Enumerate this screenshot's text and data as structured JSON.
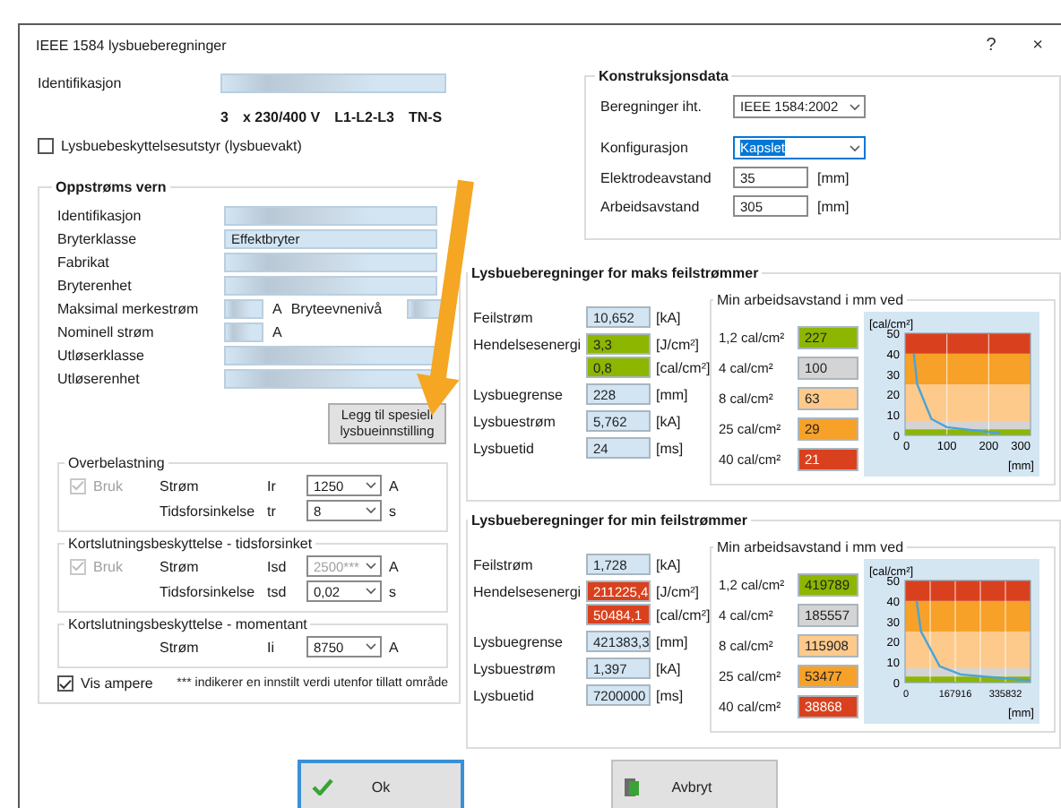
{
  "window": {
    "title": "IEEE 1584 lysbueberegninger",
    "help": "?",
    "close": "×"
  },
  "header": {
    "identification_label": "Identifikasjon",
    "system": [
      "3",
      "x 230/400 V",
      "L1-L2-L3",
      "TN-S"
    ],
    "arc_protection": {
      "label": "Lysbuebeskyttelsesutstyr (lysbuevakt)",
      "checked": false
    }
  },
  "upstream": {
    "title": "Oppstrøms vern",
    "fields": [
      {
        "kind": "blurred",
        "label": "Identifikasjon"
      },
      {
        "kind": "text",
        "label": "Bryterklasse",
        "value": "Effektbryter"
      },
      {
        "kind": "blurred",
        "label": "Fabrikat"
      },
      {
        "kind": "blurred",
        "label": "Bryterenhet"
      },
      {
        "kind": "current",
        "label": "Maksimal merkestrøm",
        "unit": "A",
        "extra_label": "Bryteevnenivå"
      },
      {
        "kind": "short",
        "label": "Nominell strøm",
        "unit": "A"
      },
      {
        "kind": "blurred",
        "label": "Utløserklasse"
      },
      {
        "kind": "blurred",
        "label": "Utløserenhet"
      }
    ],
    "button": "Legg til spesiell lysbueinnstilling",
    "groups": [
      {
        "title": "Overbelastning",
        "use": {
          "label": "Bruk",
          "checked": true,
          "disabled": true
        },
        "rows": [
          {
            "label": "Strøm",
            "symbol": "Ir",
            "value": "1250",
            "unit": "A",
            "disabled": false
          },
          {
            "label": "Tidsforsinkelse",
            "symbol": "tr",
            "value": "8",
            "unit": "s",
            "disabled": false
          }
        ]
      },
      {
        "title": "Kortslutningsbeskyttelse - tidsforsinket",
        "use": {
          "label": "Bruk",
          "checked": true,
          "disabled": true
        },
        "rows": [
          {
            "label": "Strøm",
            "symbol": "Isd",
            "value": "2500***",
            "unit": "A",
            "disabled": true
          },
          {
            "label": "Tidsforsinkelse",
            "symbol": "tsd",
            "value": "0,02",
            "unit": "s",
            "disabled": false
          }
        ]
      },
      {
        "title": "Kortslutningsbeskyttelse - momentant",
        "rows": [
          {
            "label": "Strøm",
            "symbol": "Ii",
            "value": "8750",
            "unit": "A",
            "disabled": false
          }
        ]
      }
    ],
    "show_amps": {
      "label": "Vis ampere",
      "checked": true
    },
    "note": "*** indikerer en innstilt verdi utenfor tillatt område"
  },
  "construction": {
    "title": "Konstruksjonsdata",
    "rows": [
      {
        "kind": "select",
        "label": "Beregninger iht.",
        "value": "IEEE 1584:2002",
        "focused": false
      },
      {
        "kind": "select",
        "label": "Konfigurasjon",
        "value": "Kapslet",
        "focused": true
      },
      {
        "kind": "input",
        "label": "Elektrodeavstand",
        "value": "35",
        "unit": "[mm]"
      },
      {
        "kind": "input",
        "label": "Arbeidsavstand",
        "value": "305",
        "unit": "[mm]"
      }
    ]
  },
  "results": [
    {
      "title": "Lysbueberegninger for maks feilstrømmer",
      "rows": [
        {
          "label": "Feilstrøm",
          "values": [
            {
              "value": "10,652",
              "unit": "[kA]",
              "color": "#d3e5f3"
            }
          ]
        },
        {
          "label": "Hendelsesenergi",
          "values": [
            {
              "value": "3,3",
              "unit": "[J/cm²]",
              "color": "#8db600"
            },
            {
              "value": "0,8",
              "unit": "[cal/cm²]",
              "color": "#8db600"
            }
          ]
        },
        {
          "label": "Lysbuegrense",
          "values": [
            {
              "value": "228",
              "unit": "[mm]",
              "color": "#d3e5f3"
            }
          ]
        },
        {
          "label": "Lysbuestrøm",
          "values": [
            {
              "value": "5,762",
              "unit": "[kA]",
              "color": "#d3e5f3"
            }
          ]
        },
        {
          "label": "Lysbuetid",
          "values": [
            {
              "value": "24",
              "unit": "[ms]",
              "color": "#d3e5f3"
            }
          ]
        }
      ],
      "distance": {
        "title": "Min arbeidsavstand i mm ved",
        "rows": [
          {
            "label": "1,2 cal/cm²",
            "value": "227",
            "color": "#8db600"
          },
          {
            "label": "4 cal/cm²",
            "value": "100",
            "color": "#d4d4d4"
          },
          {
            "label": "8 cal/cm²",
            "value": "63",
            "color": "#fdca8c"
          },
          {
            "label": "25 cal/cm²",
            "value": "29",
            "color": "#f7a128"
          },
          {
            "label": "40 cal/cm²",
            "value": "21",
            "color": "#d9411e"
          }
        ]
      },
      "chart_data": {
        "type": "line",
        "ylabel": "[cal/cm²]",
        "xlabel": "[mm]",
        "xlim": [
          0,
          300
        ],
        "ylim": [
          0,
          50
        ],
        "xticks": [
          0,
          100,
          200,
          300
        ],
        "yticks": [
          0,
          10,
          20,
          30,
          40,
          50
        ],
        "grid": true,
        "x": [
          21,
          29,
          63,
          100,
          227
        ],
        "bands": [
          {
            "axis": "y",
            "from": 0,
            "to": 3,
            "color": "#8db600"
          },
          {
            "axis": "y",
            "from": 3,
            "to": 7,
            "color": "#d4d4d4"
          },
          {
            "axis": "y",
            "from": 7,
            "to": 25,
            "color": "#fdca8c"
          },
          {
            "axis": "y",
            "from": 25,
            "to": 40,
            "color": "#f7a128"
          },
          {
            "axis": "y",
            "from": 40,
            "to": 50,
            "color": "#d9411e"
          }
        ],
        "series": [
          {
            "color": "#4aa3d8",
            "values": [
              40,
              25,
              8,
              4,
              1
            ]
          }
        ]
      }
    },
    {
      "title": "Lysbueberegninger for min feilstrømmer",
      "rows": [
        {
          "label": "Feilstrøm",
          "values": [
            {
              "value": "1,728",
              "unit": "[kA]",
              "color": "#d3e5f3"
            }
          ]
        },
        {
          "label": "Hendelsesenergi",
          "values": [
            {
              "value": "211225,4",
              "unit": "[J/cm²]",
              "color": "#d9411e"
            },
            {
              "value": "50484,1",
              "unit": "[cal/cm²]",
              "color": "#d9411e"
            }
          ]
        },
        {
          "label": "Lysbuegrense",
          "values": [
            {
              "value": "421383,3",
              "unit": "[mm]",
              "color": "#d3e5f3"
            }
          ]
        },
        {
          "label": "Lysbuestrøm",
          "values": [
            {
              "value": "1,397",
              "unit": "[kA]",
              "color": "#d3e5f3"
            }
          ]
        },
        {
          "label": "Lysbuetid",
          "values": [
            {
              "value": "7200000",
              "unit": "[ms]",
              "color": "#d3e5f3"
            }
          ]
        }
      ],
      "distance": {
        "title": "Min arbeidsavstand i mm ved",
        "rows": [
          {
            "label": "1,2 cal/cm²",
            "value": "419789",
            "color": "#8db600"
          },
          {
            "label": "4 cal/cm²",
            "value": "185557",
            "color": "#d4d4d4"
          },
          {
            "label": "8 cal/cm²",
            "value": "115908",
            "color": "#fdca8c"
          },
          {
            "label": "25 cal/cm²",
            "value": "53477",
            "color": "#f7a128"
          },
          {
            "label": "40 cal/cm²",
            "value": "38868",
            "color": "#d9411e"
          }
        ]
      },
      "chart_data": {
        "type": "line",
        "ylabel": "[cal/cm²]",
        "xlabel": "[mm]",
        "xlim": [
          0,
          419789
        ],
        "ylim": [
          0,
          50
        ],
        "xticks": [
          0,
          167916,
          335832
        ],
        "yticks": [
          0,
          10,
          20,
          30,
          40,
          50
        ],
        "grid": true,
        "x": [
          38868,
          53477,
          115908,
          185557,
          419789
        ],
        "bands": [
          {
            "axis": "y",
            "from": 0,
            "to": 3,
            "color": "#8db600"
          },
          {
            "axis": "y",
            "from": 3,
            "to": 7,
            "color": "#d4d4d4"
          },
          {
            "axis": "y",
            "from": 7,
            "to": 25,
            "color": "#fdca8c"
          },
          {
            "axis": "y",
            "from": 25,
            "to": 40,
            "color": "#f7a128"
          },
          {
            "axis": "y",
            "from": 40,
            "to": 50,
            "color": "#d9411e"
          }
        ],
        "series": [
          {
            "color": "#4aa3d8",
            "values": [
              40,
              25,
              8,
              4,
              1
            ]
          }
        ]
      }
    }
  ],
  "buttons": [
    {
      "kind": "ok",
      "label": "Ok",
      "default": true
    },
    {
      "kind": "cancel",
      "label": "Avbryt",
      "default": false
    }
  ]
}
